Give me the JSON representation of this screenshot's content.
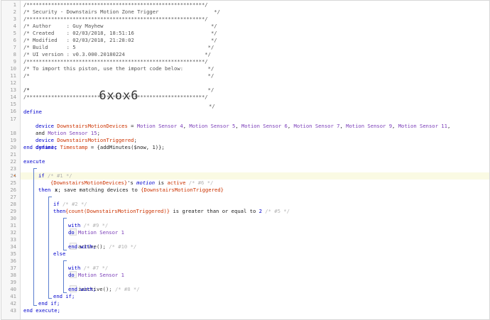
{
  "header_comments": {
    "divider": "/**********************************************************/",
    "title": "/* Security - Downstairs Motion Zone Trigger                  */",
    "author": "/* Author     : Guy Mayhew                                   */",
    "created": "/* Created    : 02/03/2018, 18:51:16                         */",
    "modified": "/* Modified   : 02/03/2018, 21:28:02                         */",
    "build": "/* Build      : 5                                           */",
    "ui_version": "/* UI version : v0.3.000.20180224                          */",
    "import_line": "/* To import this piston, use the import code below:        */",
    "empty_comment": "/*                                                          */",
    "import_code_prefix": "/*",
    "import_code": "6xox6",
    "import_code_suffix": "*/"
  },
  "line_numbers": [
    "1",
    "2",
    "3",
    "4",
    "5",
    "6",
    "7",
    "8",
    "9",
    "10",
    "11",
    "12",
    "13",
    "14",
    "15",
    "16",
    "17",
    "18",
    "19",
    "20",
    "21",
    "22",
    "23",
    "24",
    "25",
    "26",
    "27",
    "28",
    "29",
    "30",
    "31",
    "32",
    "33",
    "34",
    "35",
    "36",
    "37",
    "38",
    "39",
    "40",
    "41",
    "42",
    "43"
  ],
  "code": {
    "define": "define",
    "device": "device",
    "var_devices": "DownstairsMotionDevices",
    "eq": " = ",
    "dev1": "Motion Sensor 4",
    "dev2": "Motion Sensor 5",
    "dev3": "Motion Sensor 6",
    "dev4": "Motion Sensor 7",
    "dev5": "Motion Sensor 9",
    "dev6": "Motion Sensor 11",
    "comma": ", ",
    "comma_end": ",",
    "and": "and ",
    "dev7": "Motion Sensor 15",
    "semi": ";",
    "var_triggered": "DownstairsMotionTriggered",
    "dynamic": "dynamic",
    "var_timestamp": "Timestamp",
    "timestamp_expr": " = {addMinutes($now, 1)};",
    "end_define": "end define;",
    "execute": "execute",
    "if": "if",
    "c1": "/* #1 */",
    "cond1_a": "{DownstairsMotionDevices}",
    "cond1_b": "'s ",
    "cond1_motion": "motion",
    "cond1_c": " is ",
    "cond1_active": "active",
    "c6": "/* #6 */",
    "save_prefix": "x",
    "save_text": "; save matching devices to ",
    "save_target": "{DownstairsMotionTriggered}",
    "then": "then",
    "c2": "/* #2 */",
    "cond2_a": "{count(DownstairsMotionTriggered)}",
    "cond2_b": " is greater than or equal to ",
    "cond2_val": "2",
    "c5": "/* #5 */",
    "with": "with",
    "c9": "/* #9 */",
    "sensor1": "Motion Sensor 1",
    "do": "do",
    "active_call": "active();",
    "c10": "/* #10 */",
    "end_with": "end with;",
    "else": "else",
    "c7": "/* #7 */",
    "inactive_call": "inactive();",
    "c8": "/* #8 */",
    "end_if": "end if;",
    "end_execute": "end execute;"
  },
  "gutter_toggle": "▸"
}
